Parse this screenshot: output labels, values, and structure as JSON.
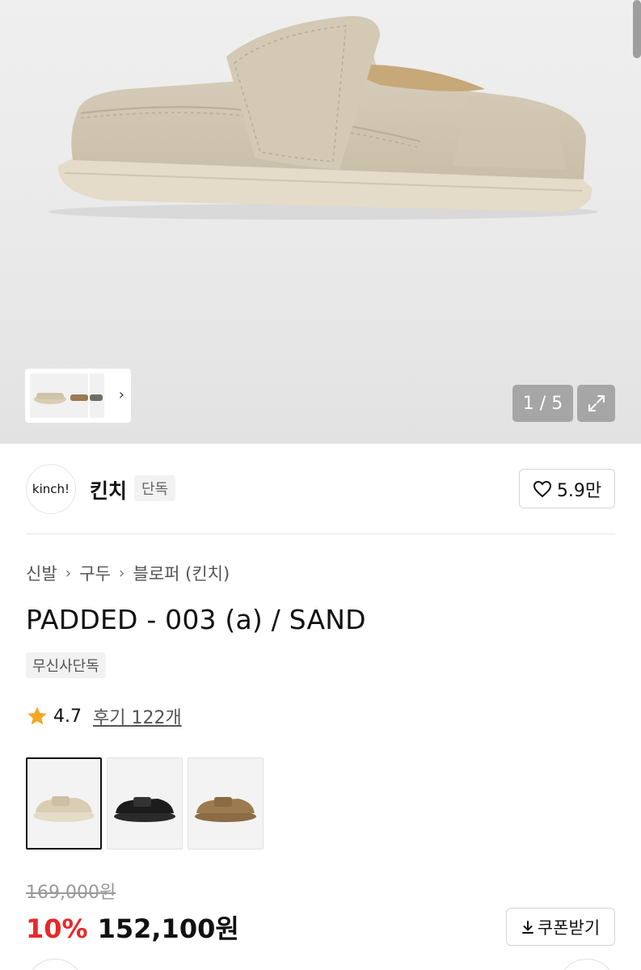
{
  "gallery": {
    "counter": "1 / 5",
    "thumb_next_icon": "chevron-right-icon",
    "expand_icon": "expand-icon"
  },
  "brand": {
    "logo_text": "kinch!",
    "name": "킨치",
    "tag": "단독",
    "like_count": "5.9만",
    "like_icon": "heart-outline-icon"
  },
  "breadcrumb": [
    "신발",
    "구두",
    "블로퍼 (킨치)"
  ],
  "product": {
    "title": "PADDED - 003 (a) / SAND",
    "badge": "무신사단독",
    "rating": "4.7",
    "reviews": "후기 122개",
    "star_color": "#f5a623"
  },
  "variants": [
    {
      "name": "sand",
      "color": "#d9cdb4"
    },
    {
      "name": "black",
      "color": "#1c1c1c"
    },
    {
      "name": "brown",
      "color": "#9c7a4f"
    }
  ],
  "pricing": {
    "original": "169,000원",
    "discount": "10%",
    "price": "152,100원",
    "discount_color": "#e8282b",
    "coupon_label": "쿠폰받기",
    "coupon_icon": "download-icon"
  }
}
